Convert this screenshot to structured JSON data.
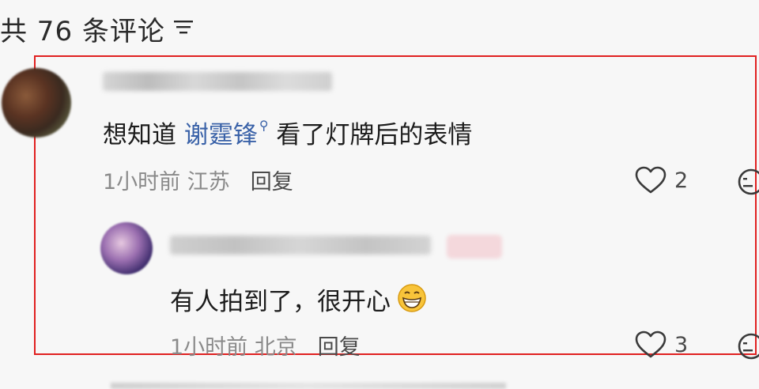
{
  "header": {
    "title": "共 76 条评论"
  },
  "comments": [
    {
      "text_before": "想知道 ",
      "mention": "谢霆锋",
      "text_after": " 看了灯牌后的表情",
      "time": "1小时前",
      "location": "江苏",
      "reply_label": "回复",
      "likes": "2"
    },
    {
      "text": "有人拍到了，很开心",
      "time": "1小时前",
      "location": "北京",
      "reply_label": "回复",
      "likes": "3"
    }
  ],
  "colors": {
    "mention": "#3a62a8",
    "highlight_border": "#e02020",
    "meta": "#8a8a8a"
  },
  "icons": [
    "sort-icon",
    "search-icon",
    "grinning-emoji-icon",
    "heart-icon",
    "dislike-face-icon"
  ]
}
